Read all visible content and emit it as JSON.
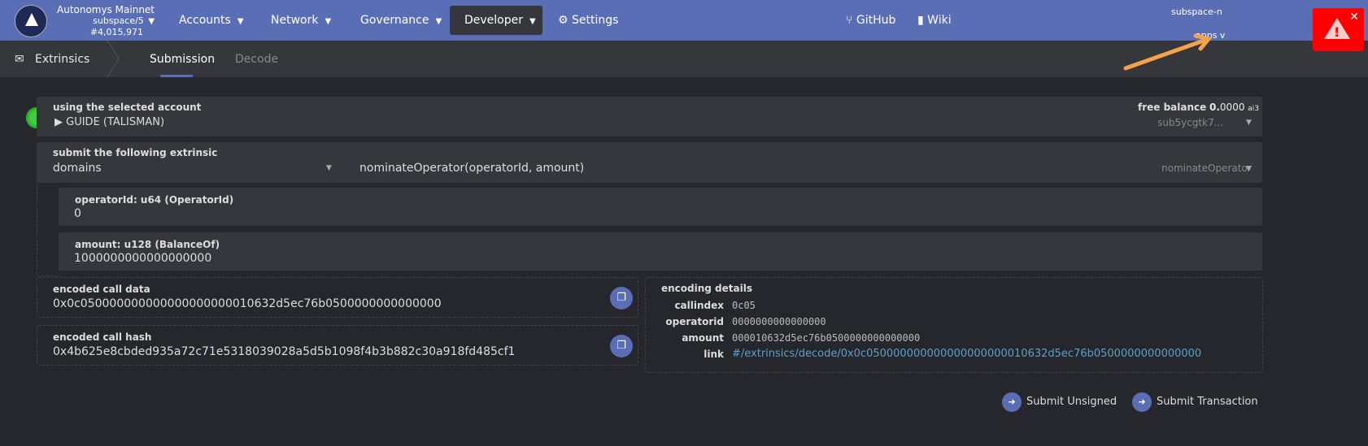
{
  "header": {
    "chain_name": "Autonomys Mainnet",
    "runtime": "subspace/5",
    "block": "#4,015,971",
    "nav": [
      {
        "label": "Accounts"
      },
      {
        "label": "Network"
      },
      {
        "label": "Governance"
      },
      {
        "label": "Developer"
      },
      {
        "label": "Settings"
      },
      {
        "label": "GitHub"
      },
      {
        "label": "Wiki"
      }
    ],
    "right_line1": "subspace-n",
    "right_line2": "apps v"
  },
  "subnav": {
    "section": "Extrinsics",
    "tabs": [
      "Submission",
      "Decode"
    ]
  },
  "account": {
    "label": "using the selected account",
    "name": "▶ GUIDE (TALISMAN)",
    "balance_label": "free balance",
    "balance_int": "0.",
    "balance_frac": "0000",
    "unit": "ai3",
    "address": "sub5ycgtk7..."
  },
  "extrinsic": {
    "label": "submit the following extrinsic",
    "pallet": "domains",
    "call": "nominateOperator(operatorId, amount)",
    "call_short": "nominateOperator"
  },
  "params": [
    {
      "label": "operatorId: u64 (OperatorId)",
      "value": "0"
    },
    {
      "label": "amount: u128 (BalanceOf)",
      "value": "1000000000000000000"
    }
  ],
  "encoded": {
    "data_label": "encoded call data",
    "data": "0x0c050000000000000000000010632d5ec76b0500000000000000",
    "hash_label": "encoded call hash",
    "hash": "0x4b625e8cbded935a72c71e5318039028a5d5b1098f4b3b882c30a918fd485cf1"
  },
  "details": {
    "title": "encoding details",
    "rows": [
      {
        "k": "callindex",
        "v": "0c05"
      },
      {
        "k": "operatorid",
        "v": "0000000000000000"
      },
      {
        "k": "amount",
        "v": "000010632d5ec76b0500000000000000"
      },
      {
        "k": "link",
        "v": "#/extrinsics/decode/0x0c050000000000000000000010632d5ec76b0500000000000000"
      }
    ]
  },
  "actions": {
    "unsigned": "Submit Unsigned",
    "signed": "Submit Transaction"
  },
  "colors": {
    "header": "#5a6eb5",
    "warning": "#ff0000",
    "arrow": "#f5a34a",
    "link": "#5aa0c8"
  }
}
